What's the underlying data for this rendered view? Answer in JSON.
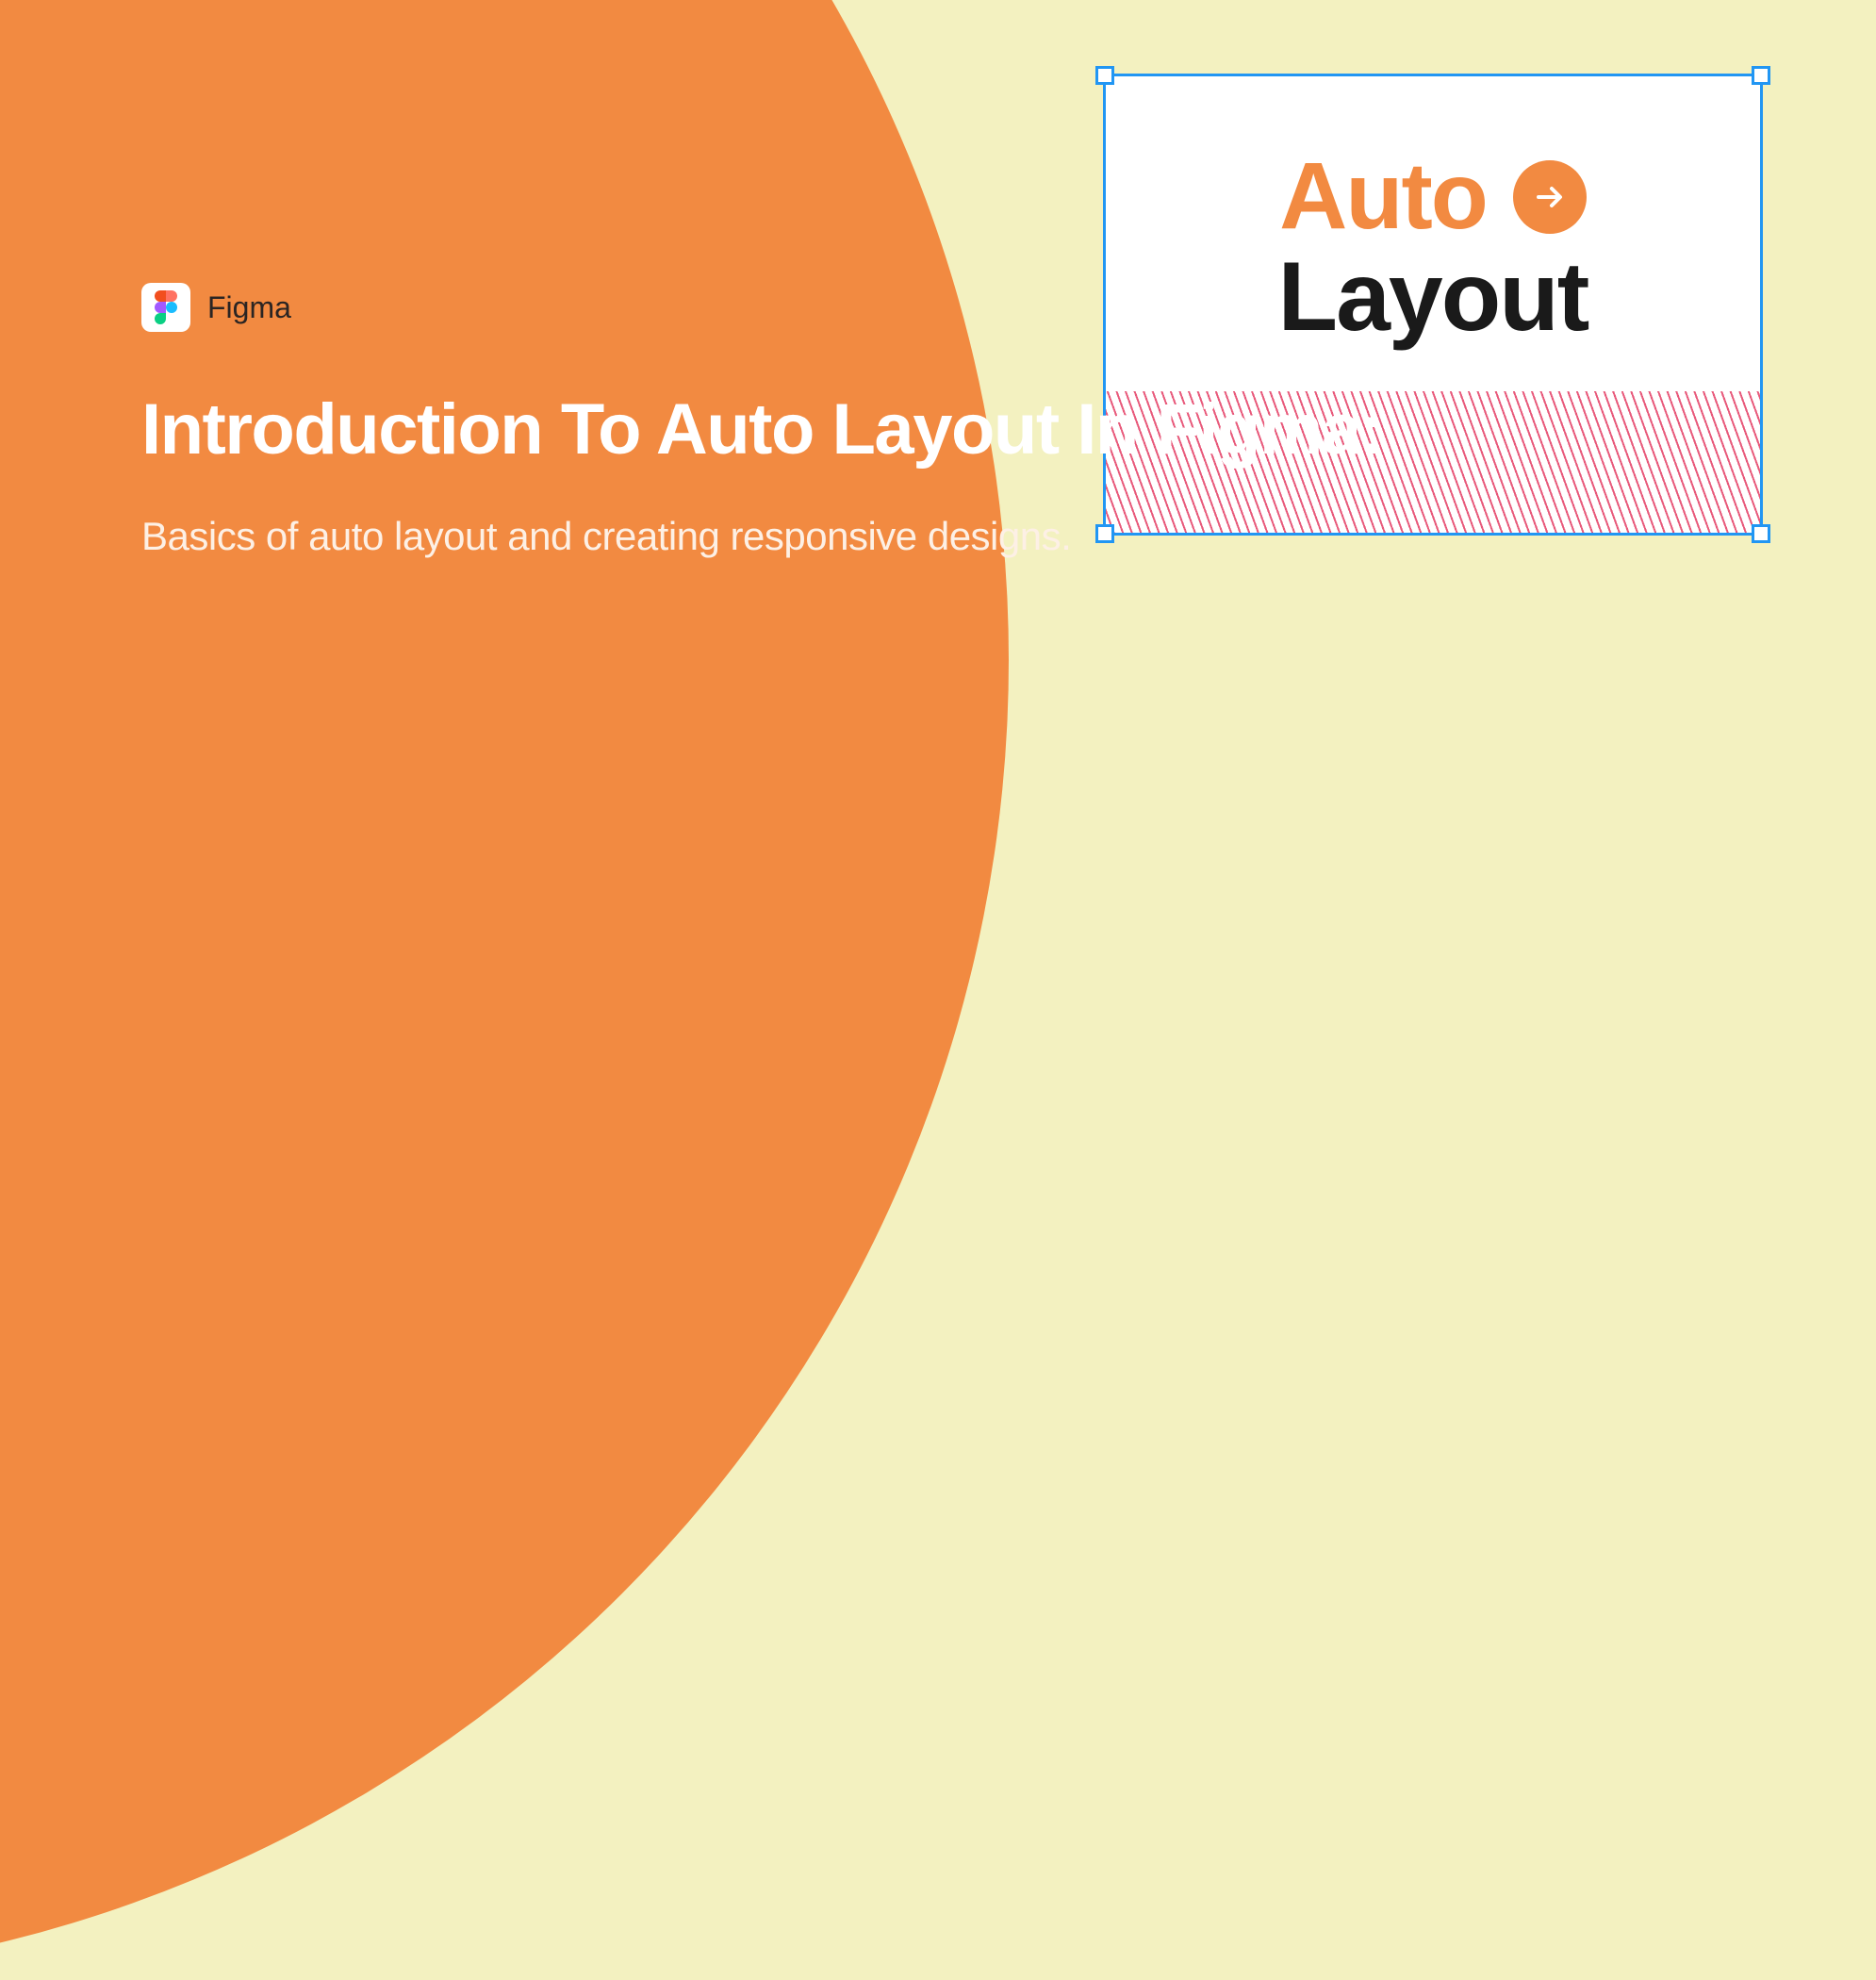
{
  "brand": {
    "name": "Figma"
  },
  "hero": {
    "title": "Introduction To Auto Layout In Figma:",
    "subtitle": "Basics of auto layout and creating responsive designs."
  },
  "frame": {
    "word_top": "Auto",
    "word_bottom": "Layout"
  },
  "colors": {
    "accent_orange": "#F28A41",
    "cream_bg": "#F3F1C0",
    "selection_blue": "#2196F3",
    "hatch_pink": "#E85A7B",
    "text_dark": "#1a1a1a",
    "white": "#ffffff"
  }
}
